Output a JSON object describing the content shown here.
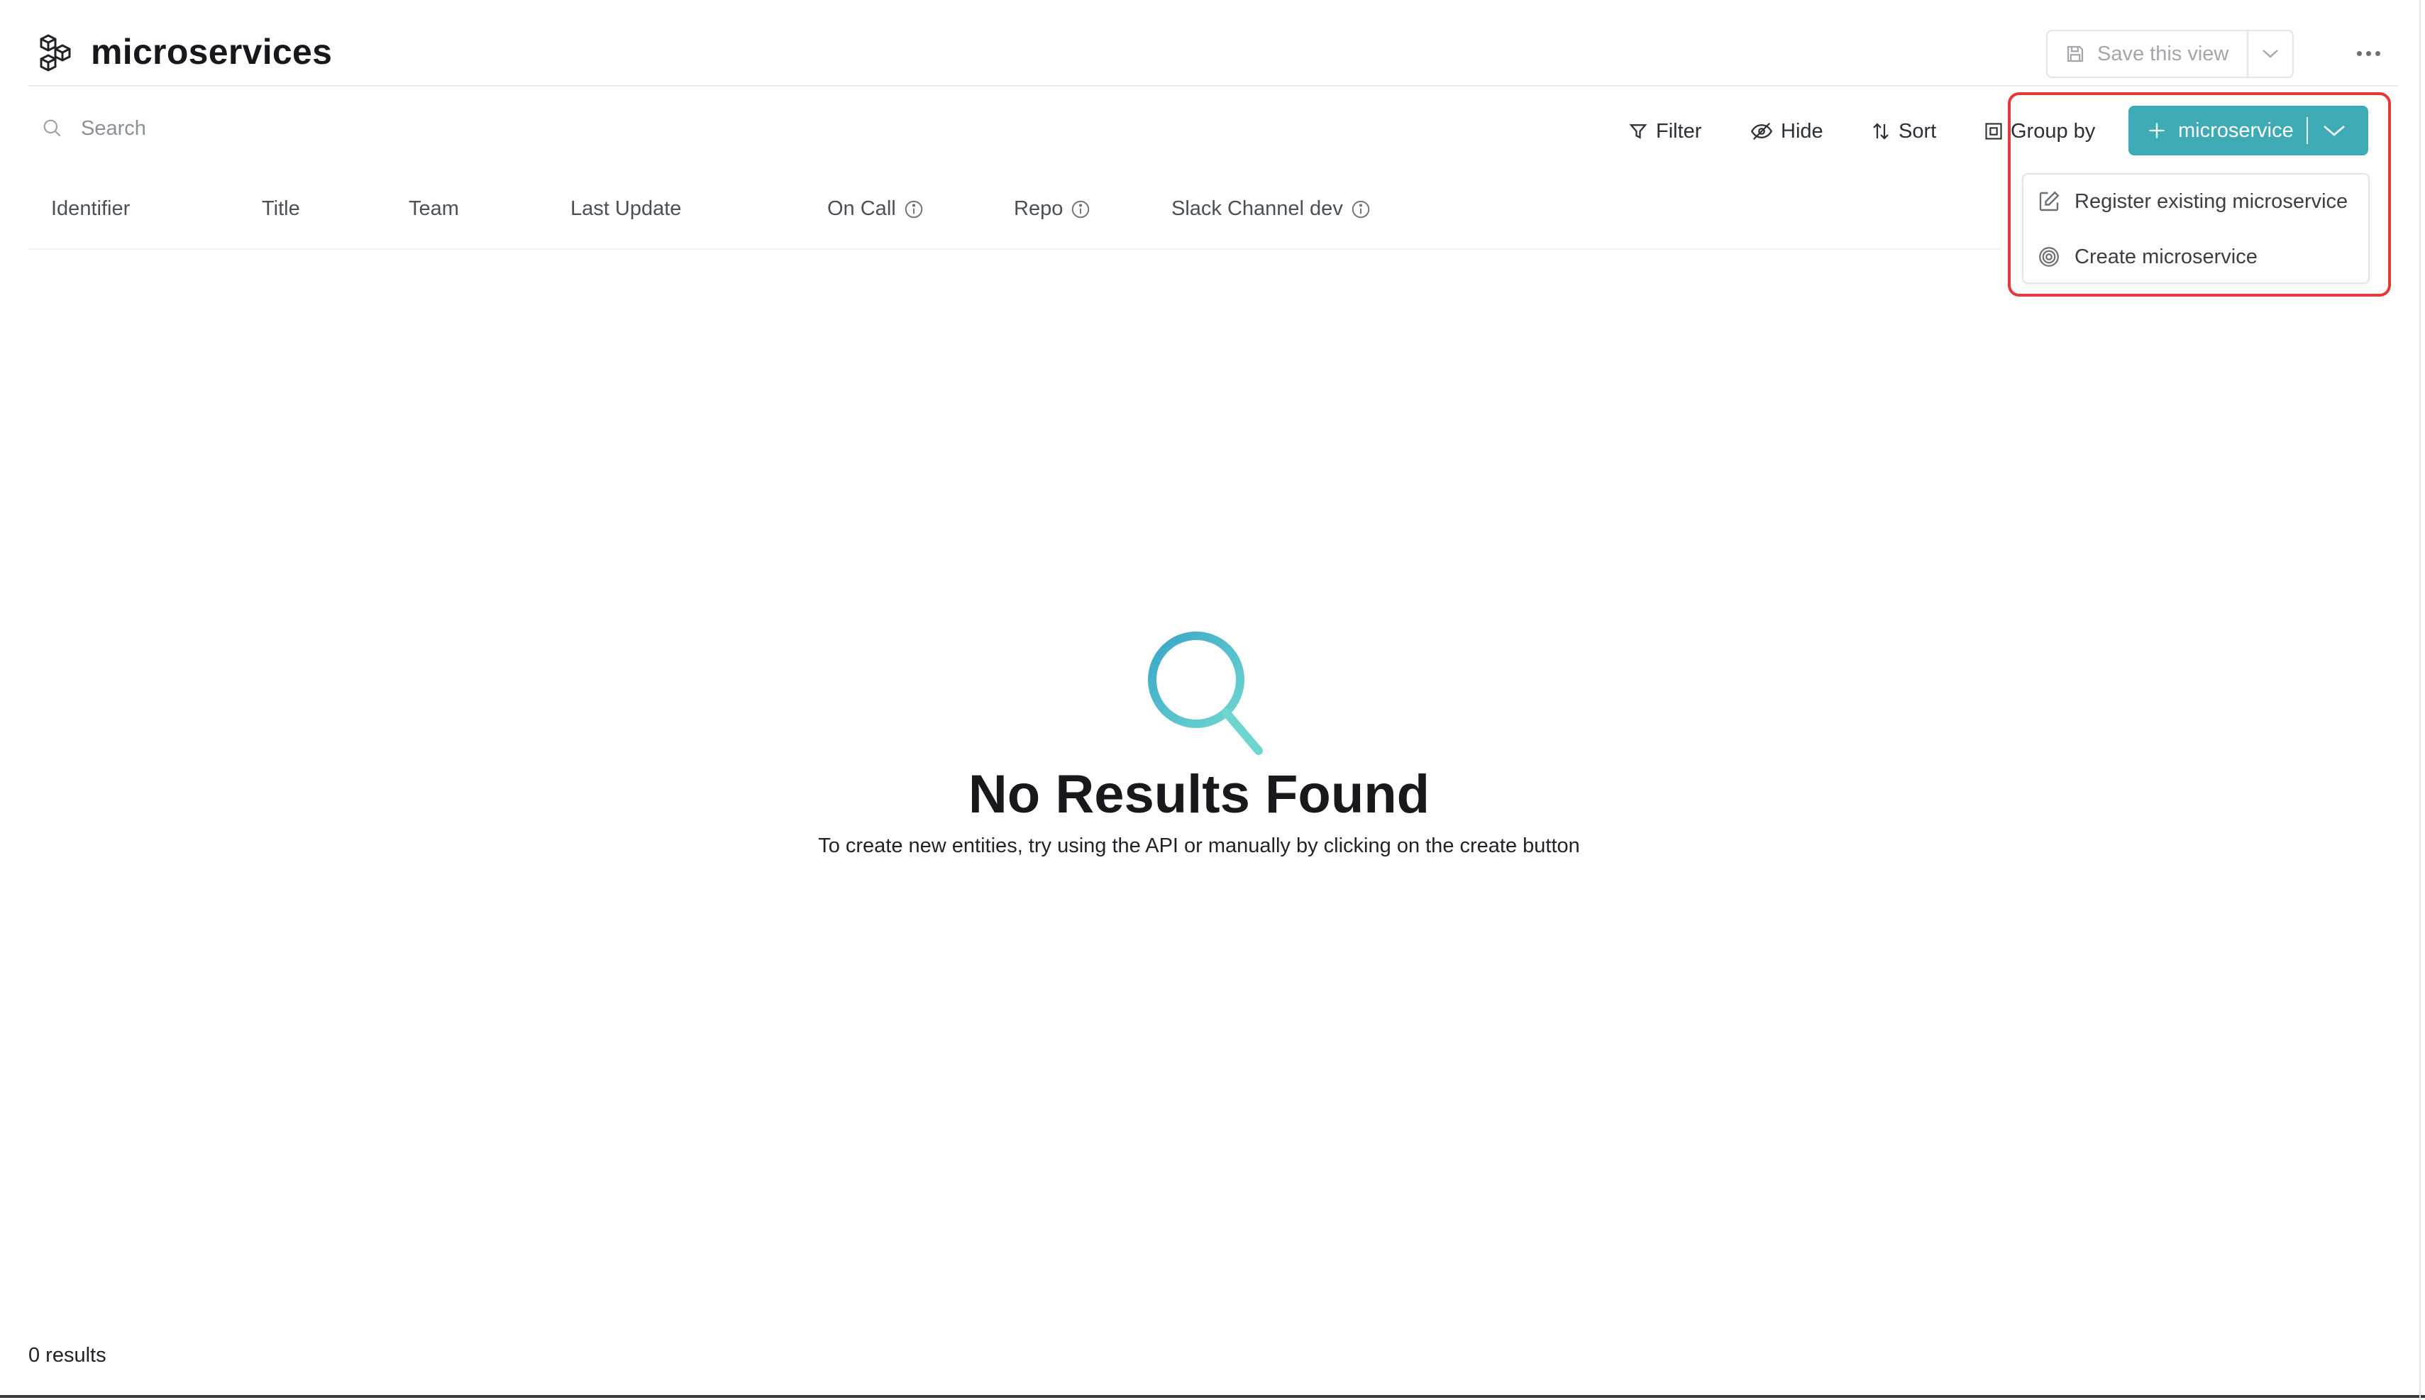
{
  "header": {
    "title": "microservices",
    "icon": "cubes-icon",
    "save_view_label": "Save this view"
  },
  "toolbar": {
    "search_placeholder": "Search",
    "filter_label": "Filter",
    "hide_label": "Hide",
    "sort_label": "Sort",
    "group_by_label": "Group by",
    "create_label": "microservice",
    "accent_color": "#3eaab5"
  },
  "dropdown": {
    "items": [
      {
        "label": "Register existing microservice",
        "icon": "edit-icon"
      },
      {
        "label": "Create microservice",
        "icon": "target-icon"
      }
    ]
  },
  "table": {
    "columns": [
      {
        "label": "Identifier",
        "info": false
      },
      {
        "label": "Title",
        "info": false
      },
      {
        "label": "Team",
        "info": false
      },
      {
        "label": "Last Update",
        "info": false
      },
      {
        "label": "On Call",
        "info": true
      },
      {
        "label": "Repo",
        "info": true
      },
      {
        "label": "Slack Channel dev",
        "info": true
      }
    ]
  },
  "empty_state": {
    "title": "No Results Found",
    "description": "To create new entities, try using the API or manually by clicking on the create button"
  },
  "footer": {
    "results": "0 results"
  },
  "highlight_color": "#e53935"
}
